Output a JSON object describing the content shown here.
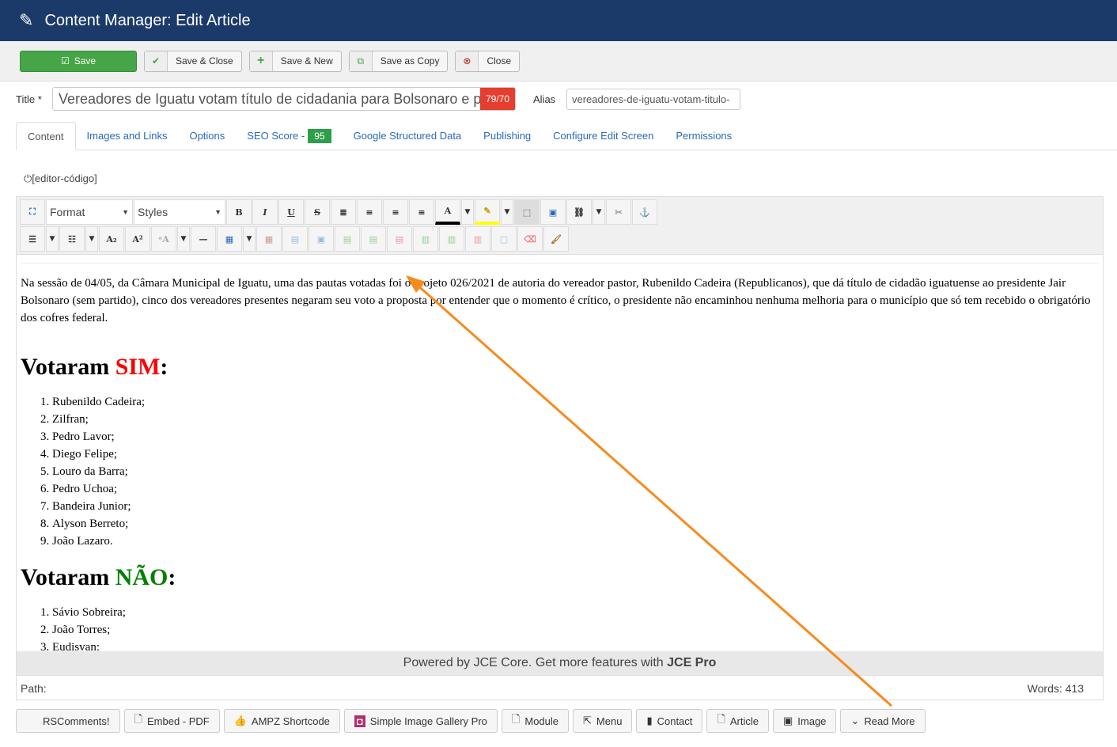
{
  "header": {
    "title": "Content Manager: Edit Article"
  },
  "toolbar": {
    "save": "Save",
    "save_close": "Save & Close",
    "save_new": "Save & New",
    "save_copy": "Save as Copy",
    "close": "Close"
  },
  "title_field": {
    "label": "Title *",
    "value": "Vereadores de Iguatu votam título de cidadania para Bolsonaro e p",
    "counter": "79/70"
  },
  "alias_field": {
    "label": "Alias",
    "value": "vereadores-de-iguatu-votam-titulo-"
  },
  "tabs": [
    {
      "label": "Content"
    },
    {
      "label": "Images and Links"
    },
    {
      "label": "Options"
    },
    {
      "label": "SEO Score -",
      "badge": "95"
    },
    {
      "label": "Google Structured Data"
    },
    {
      "label": "Publishing"
    },
    {
      "label": "Configure Edit Screen"
    },
    {
      "label": "Permissions"
    }
  ],
  "editor_toggle": "[editor-código]",
  "editor": {
    "format": "Format",
    "styles": "Styles",
    "paragraph": "Na sessão de 04/05, da Câmara Municipal de Iguatu, uma das pautas votadas foi o projeto 026/2021 de autoria do vereador pastor, Rubenildo Cadeira (Republicanos), que dá título de cidadão iguatuense ao presidente Jair Bolsonaro (sem partido), cinco dos vereadores presentes negaram seu voto a proposta por entender que o momento é crítico, o presidente não encaminhou nenhuma melhoria para o município que só tem recebido o obrigatório dos cofres federal.",
    "h_sim_prefix": "Votaram ",
    "h_sim": "SIM",
    "h_nao": "NÃO",
    "h_suffix": ":",
    "sim_list": [
      "Rubenildo Cadeira;",
      "Zilfran;",
      "Pedro Lavor;",
      "Diego Felipe;",
      "Louro da Barra;",
      "Pedro Uchoa;",
      "Bandeira Junior;",
      "Alyson Berreto;",
      "João Lazaro."
    ],
    "nao_list": [
      "Sávio Sobreira;",
      "João Torres;",
      "Eudisvan;"
    ],
    "powered": "Powered by JCE Core. Get more features with ",
    "powered_bold": "JCE Pro",
    "path": "Path:",
    "words": "Words: 413"
  },
  "bottom_buttons": [
    "RSComments!",
    "Embed - PDF",
    "AMPZ Shortcode",
    "Simple Image Gallery Pro",
    "Module",
    "Menu",
    "Contact",
    "Article",
    "Image",
    "Read More"
  ],
  "colors": {
    "header": "#1b3a69",
    "save": "#46a546",
    "sim": "#ff0000",
    "nao": "#008000",
    "arrow": "#f68b1f"
  }
}
